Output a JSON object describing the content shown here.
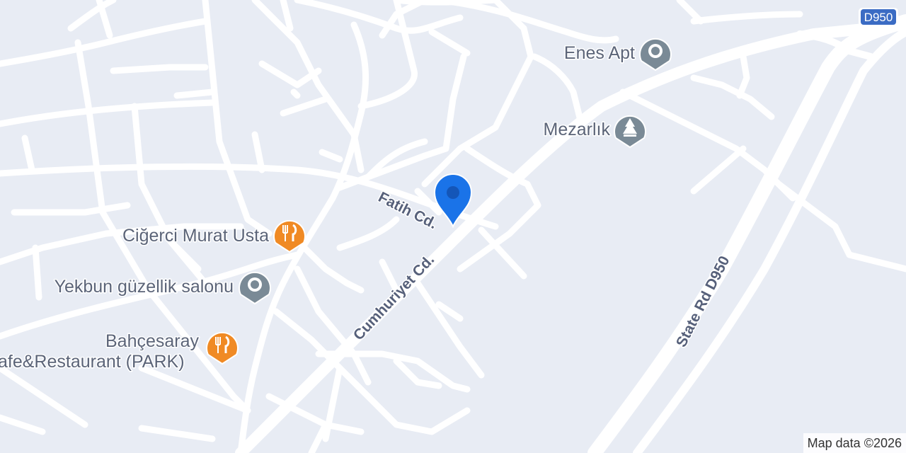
{
  "map": {
    "background_color": "#e8ecf4",
    "road_color": "#ffffff",
    "pois": [
      {
        "name": "Enes Apt",
        "icon": "generic-poi-icon",
        "color": "#7a8a96"
      },
      {
        "name": "Mezarlık",
        "icon": "cemetery-icon",
        "color": "#7a8a96"
      },
      {
        "name": "Ciğerci Murat Usta",
        "icon": "restaurant-icon",
        "color": "#f08a24"
      },
      {
        "name": "Yekbun güzellik salonu",
        "icon": "generic-poi-icon",
        "color": "#7a8a96"
      },
      {
        "name": "Bahçesaray",
        "name_line2": "afe&Restaurant (PARK)",
        "icon": "restaurant-icon",
        "color": "#f08a24"
      }
    ],
    "streets": [
      "Fatih Cd.",
      "Cumhuriyet Cd.",
      "State Rd D950"
    ],
    "highway_shield": {
      "label": "D950",
      "color": "#3b6cc4"
    },
    "location_marker": {
      "icon": "location-pin-icon",
      "color": "#1a73e8"
    },
    "attribution": "Map data ©2026"
  }
}
